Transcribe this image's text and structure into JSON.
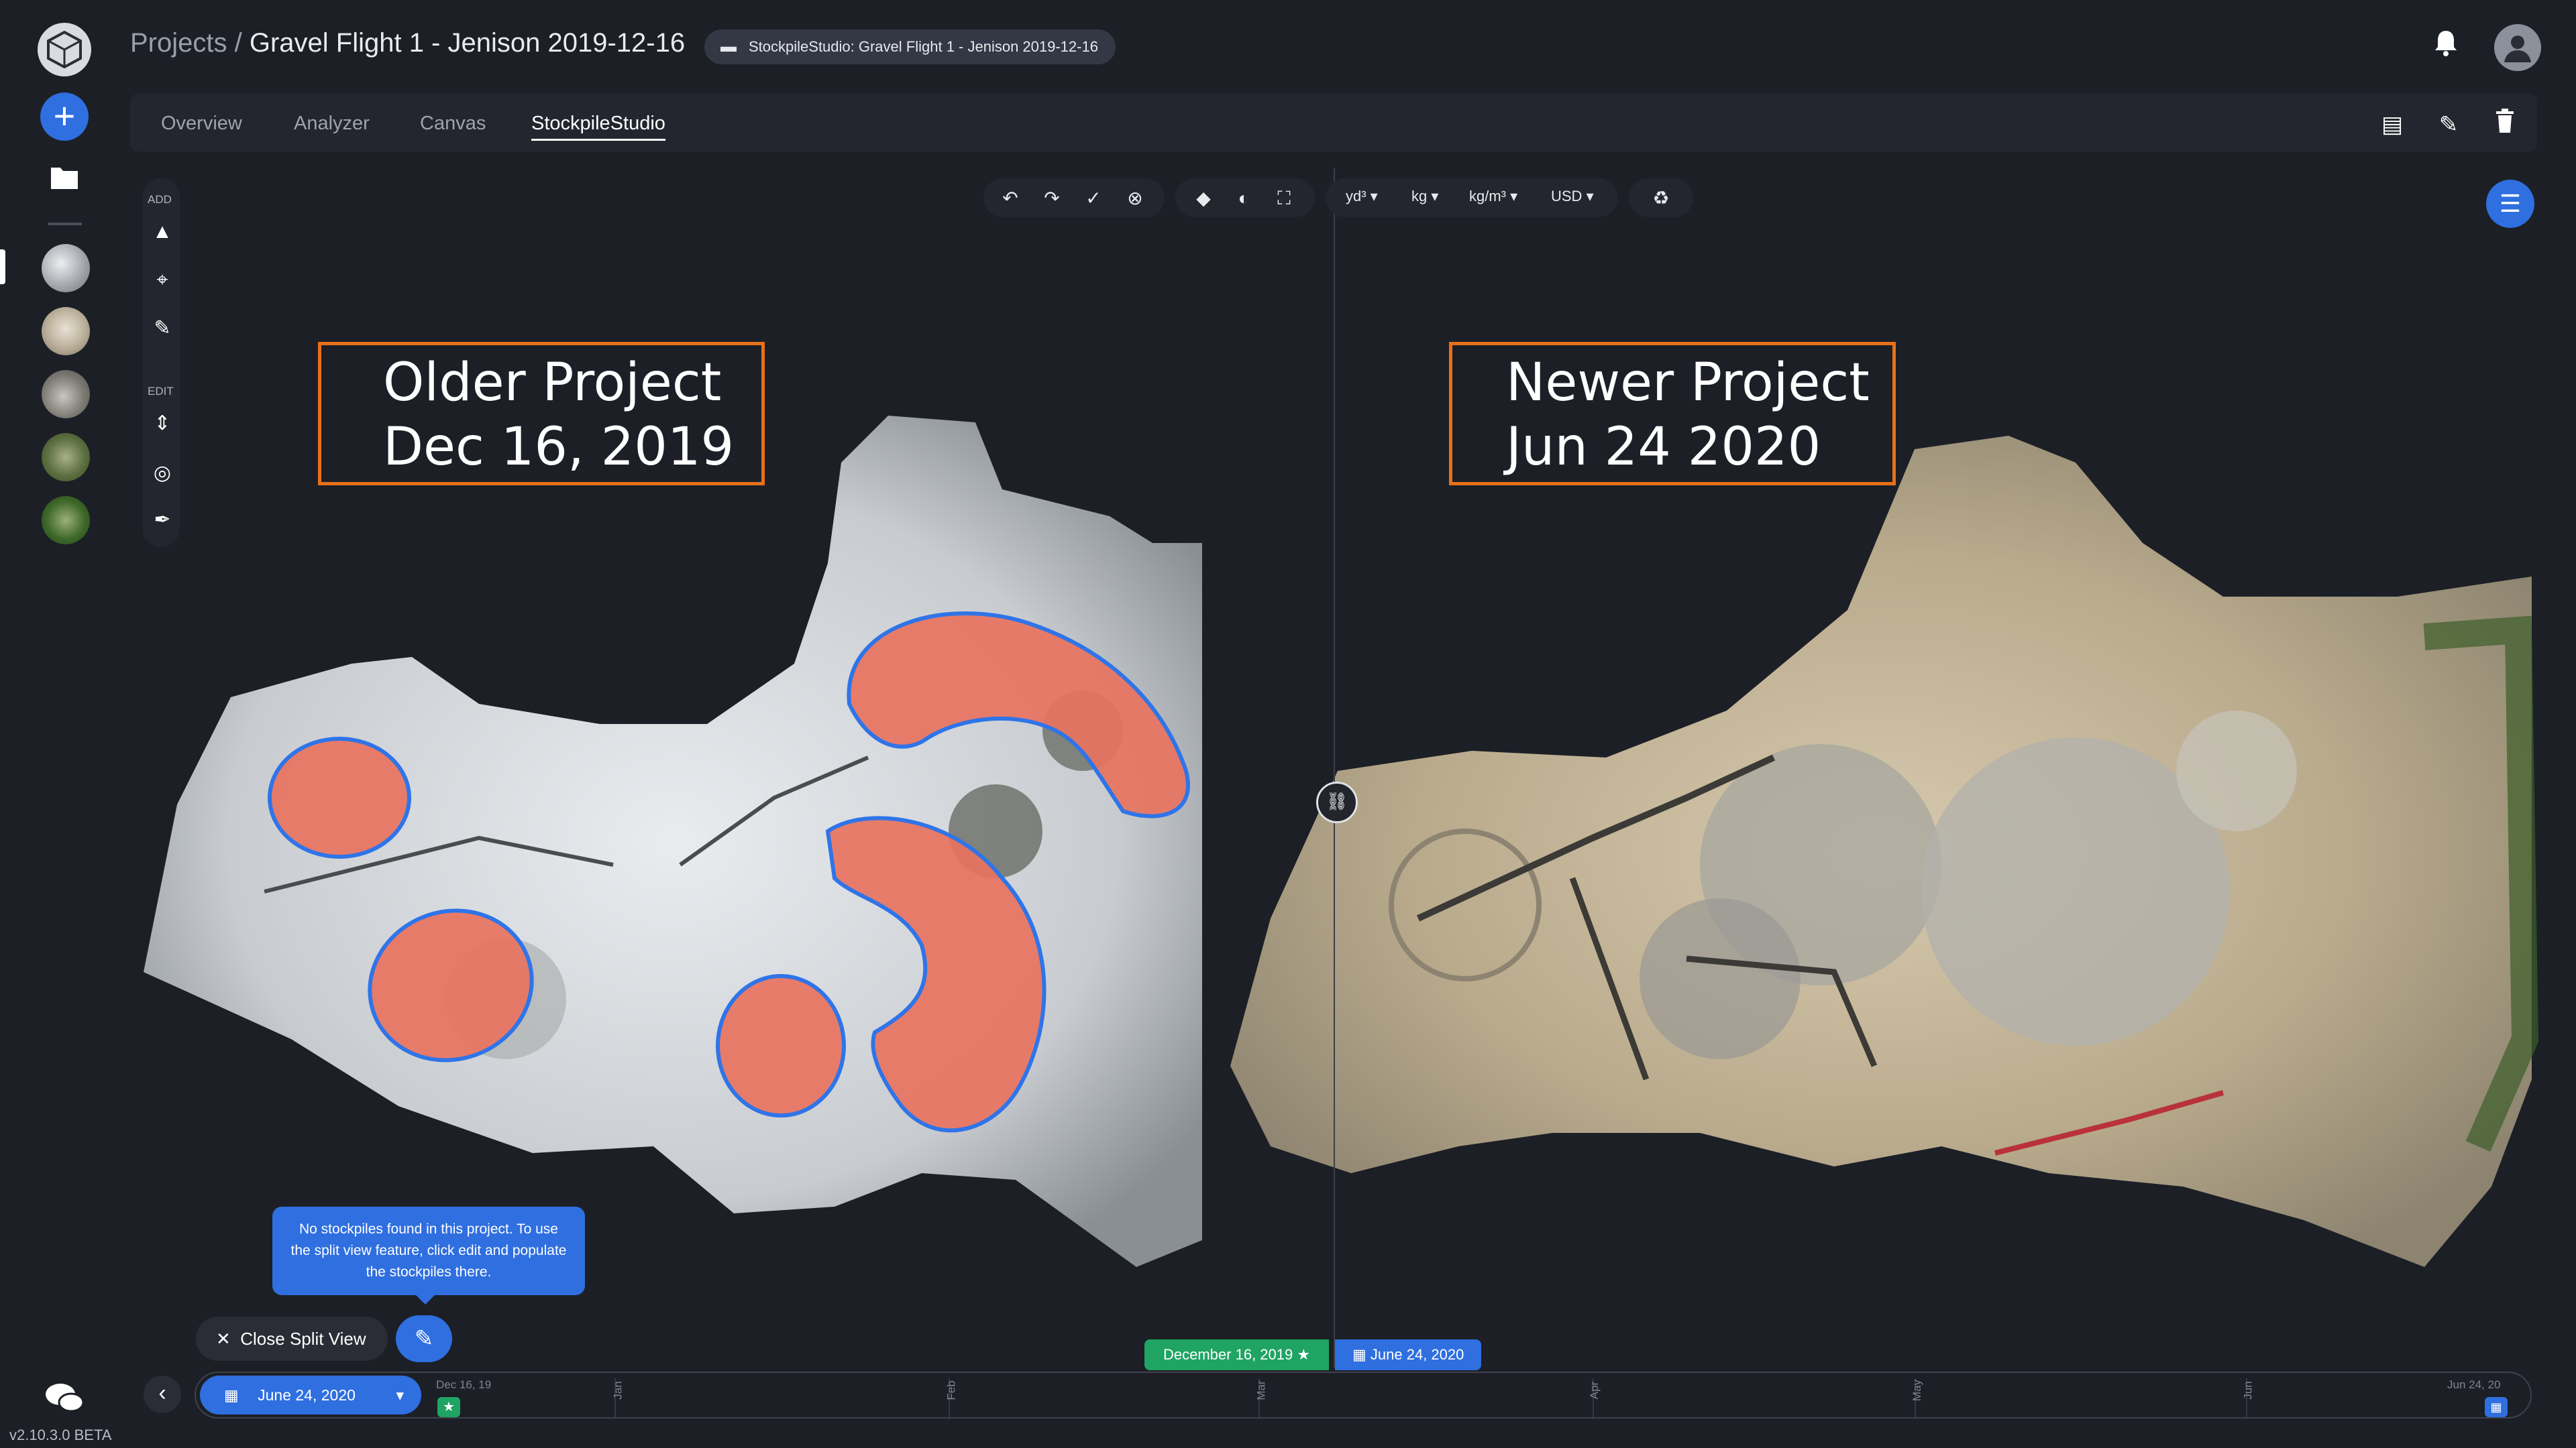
{
  "header": {
    "breadcrumb_root": "Projects /",
    "breadcrumb_current": "Gravel Flight 1 - Jenison 2019-12-16",
    "project_chip": "StockpileStudio: Gravel Flight 1 - Jenison 2019-12-16"
  },
  "tabs": [
    "Overview",
    "Analyzer",
    "Canvas",
    "StockpileStudio"
  ],
  "active_tab": "StockpileStudio",
  "tools": {
    "add_label": "ADD",
    "edit_label": "EDIT"
  },
  "units": [
    "yd³",
    "kg",
    "kg/m³",
    "USD"
  ],
  "overlays": {
    "older_line1": "Older Project",
    "older_line2": "Dec 16, 2019",
    "newer_line1": "Newer Project",
    "newer_line2": "Jun 24 2020"
  },
  "tooltip": "No stockpiles found in this project. To use the split view feature, click edit and populate the stockpiles there.",
  "close_split_label": "Close Split View",
  "dates": {
    "older": "December 16, 2019",
    "newer": "June 24, 2020",
    "selected": "June 24, 2020"
  },
  "timeline_ticks": [
    "Dec 16, 19",
    "Jan",
    "Feb",
    "Mar",
    "Apr",
    "May",
    "Jun",
    "Jun 24, 20"
  ],
  "version": "v2.10.3.0 BETA",
  "colors": {
    "accent": "#2f6fe0",
    "green": "#1fa463",
    "label_border": "#e8701a",
    "stockpile": "#e8735f"
  }
}
